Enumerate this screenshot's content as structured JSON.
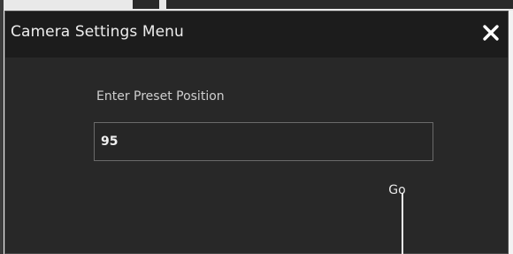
{
  "dialog": {
    "title": "Camera Settings Menu",
    "close_icon": "close-icon"
  },
  "form": {
    "label": "Enter Preset Position",
    "preset_value": "95",
    "go_label": "Go"
  },
  "colors": {
    "dialog_bg": "#282828",
    "titlebar_bg": "#1c1c1c",
    "text": "#ededed",
    "input_border": "#6a6a6a"
  }
}
